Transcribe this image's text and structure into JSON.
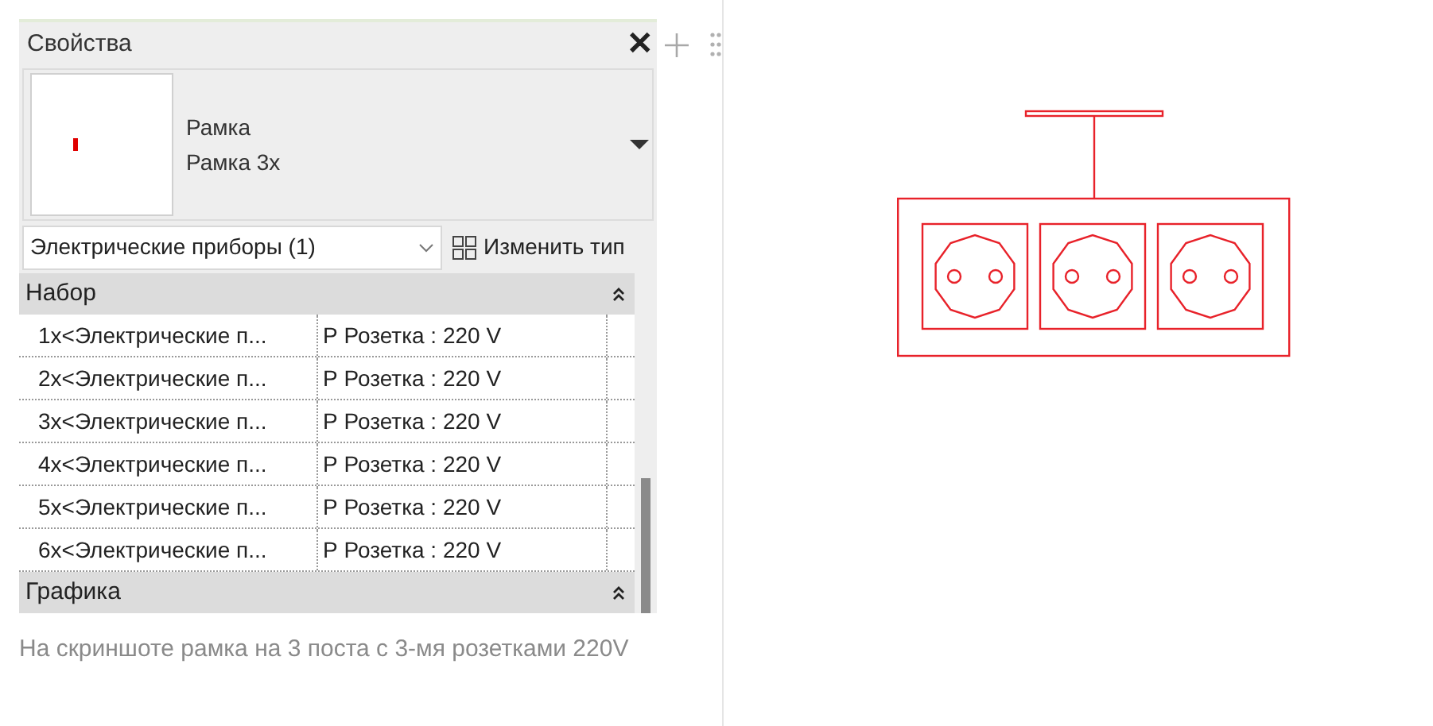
{
  "panel": {
    "title": "Свойства",
    "close": "✕",
    "family": "Рамка",
    "type": "Рамка 3х",
    "category": "Электрические приборы (1)",
    "edit_type": "Изменить тип",
    "sections": [
      {
        "title": "Набор",
        "expanded": true,
        "rows": [
          {
            "name": "1x<Электрические п...",
            "value": "Р Розетка : 220 V"
          },
          {
            "name": "2x<Электрические п...",
            "value": "Р Розетка : 220 V"
          },
          {
            "name": "3x<Электрические п...",
            "value": "Р Розетка : 220 V"
          },
          {
            "name": "4x<Электрические п...",
            "value": "Р Розетка : 220 V"
          },
          {
            "name": "5x<Электрические п...",
            "value": "Р Розетка : 220 V"
          },
          {
            "name": "6x<Электрические п...",
            "value": "Р Розетка : 220 V"
          }
        ]
      },
      {
        "title": "Графика",
        "expanded": true
      }
    ]
  },
  "caption": "На скриншоте рамка на 3 поста с 3-мя розетками 220V"
}
